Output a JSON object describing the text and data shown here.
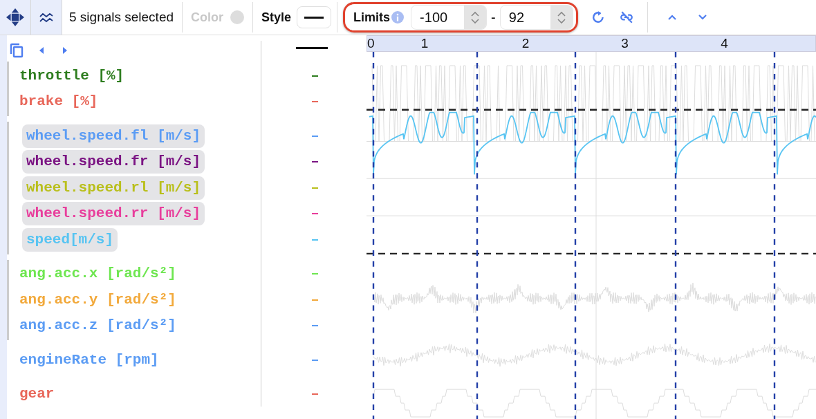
{
  "toolbar": {
    "selection": "5 signals selected",
    "color_label": "Color",
    "color_disabled": true,
    "style_label": "Style",
    "limits_label": "Limits",
    "limit_min": "-100",
    "limit_separator": "-",
    "limit_max": "92"
  },
  "signal_groups": [
    {
      "grouped": true,
      "signals": [
        {
          "name": "throttle [%]",
          "color": "#2e7d1f",
          "selected": false
        },
        {
          "name": "brake [%]",
          "color": "#e8675a",
          "selected": false
        }
      ]
    },
    {
      "grouped": true,
      "signals": [
        {
          "name": "wheel.speed.fl [m/s]",
          "color": "#5b9cf4",
          "selected": true
        },
        {
          "name": "wheel.speed.fr [m/s]",
          "color": "#7b1483",
          "selected": true
        },
        {
          "name": "wheel.speed.rl [m/s]",
          "color": "#b9bf1c",
          "selected": true
        },
        {
          "name": "wheel.speed.rr [m/s]",
          "color": "#e83e9c",
          "selected": true
        },
        {
          "name": "speed[m/s]",
          "color": "#57c4f2",
          "selected": true
        }
      ]
    },
    {
      "grouped": true,
      "signals": [
        {
          "name": "ang.acc.x [rad/s²]",
          "color": "#6ee650",
          "selected": false
        },
        {
          "name": "ang.acc.y [rad/s²]",
          "color": "#f2a93b",
          "selected": false
        },
        {
          "name": "ang.acc.z [rad/s²]",
          "color": "#5b9cf4",
          "selected": false
        }
      ]
    },
    {
      "grouped": false,
      "signals": [
        {
          "name": "engineRate [rpm]",
          "color": "#5b9cf4",
          "selected": false
        }
      ]
    },
    {
      "grouped": false,
      "signals": [
        {
          "name": "gear",
          "color": "#e8675a",
          "selected": false
        }
      ]
    }
  ],
  "laps": [
    "0",
    "1",
    "2",
    "3",
    "4"
  ]
}
